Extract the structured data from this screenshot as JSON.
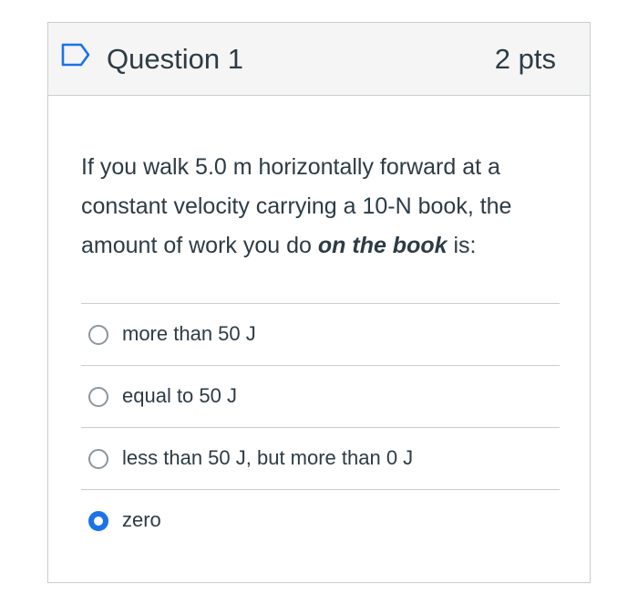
{
  "question": {
    "title": "Question 1",
    "points": "2 pts",
    "flag_icon": "flag-outline-icon",
    "text_before": "If you walk 5.0 m horizontally forward at a constant velocity carrying a 10-N book, the amount of work you do ",
    "text_emphasis": "on the book",
    "text_after": " is:"
  },
  "answers": [
    {
      "label": "more than 50 J",
      "selected": false
    },
    {
      "label": "equal to 50 J",
      "selected": false
    },
    {
      "label": "less than 50 J, but more than 0 J",
      "selected": false
    },
    {
      "label": "zero",
      "selected": true
    }
  ],
  "colors": {
    "selected_radio": "#1a73e8",
    "text": "#2d3b45",
    "header_bg": "#f5f5f5",
    "border": "#c7cdd1"
  }
}
